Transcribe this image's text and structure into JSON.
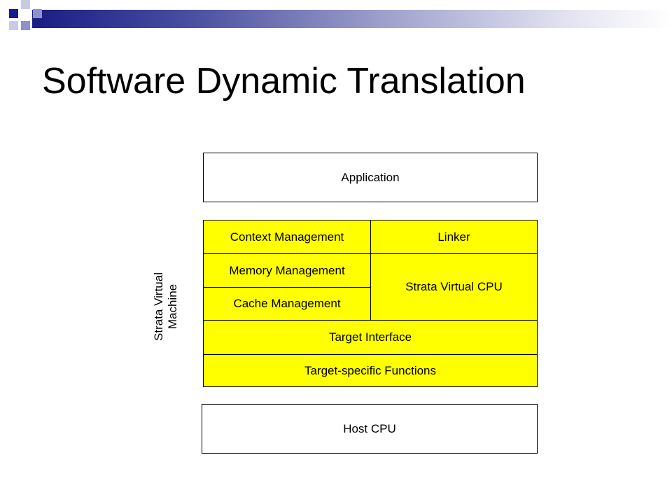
{
  "slide": {
    "title": "Software Dynamic Translation"
  },
  "diagram": {
    "application": "Application",
    "context_management": "Context Management",
    "linker": "Linker",
    "memory_management": "Memory Management",
    "strata_virtual_cpu": "Strata Virtual CPU",
    "cache_management": "Cache Management",
    "target_interface": "Target Interface",
    "target_specific_functions": "Target-specific Functions",
    "host_cpu": "Host CPU",
    "side_label_line1": "Strata Virtual",
    "side_label_line2": "Machine"
  },
  "colors": {
    "highlight": "#ffff00",
    "accent": "#161a8a"
  }
}
